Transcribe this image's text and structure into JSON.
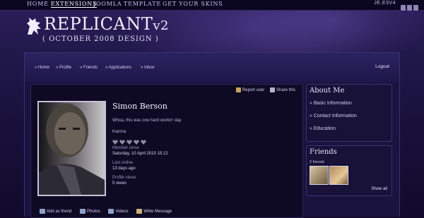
{
  "top_nav": {
    "items": [
      "HOME",
      "EXTENSIONS",
      "JOOMLA",
      "TEMPLATE",
      "GET YOUR SKINS"
    ],
    "right_text": "JE.E3V4"
  },
  "logo": {
    "title": "REPLICANT",
    "version": "v2",
    "subtitle": "( OCTOBER 2008 DESIGN )"
  },
  "sub_nav": {
    "items": [
      "» Home",
      "» Profile",
      "» Friends",
      "» Applications",
      "» Inbox"
    ],
    "logout": "Logout"
  },
  "profile": {
    "report_user": "Report user",
    "share_this": "Share this",
    "name": "Simon Berson",
    "status": "Whoa, this was one hard workin' day",
    "karma_label": "Karma",
    "karma_count": 5,
    "member_since_label": "Member since",
    "member_since": "Saturday, 10 April 2010 15:12",
    "last_online_label": "Last online",
    "last_online": "13 days ago",
    "profile_views_label": "Profile views",
    "profile_views": "5 views",
    "actions": [
      "Add as friend",
      "Photos",
      "Videos",
      "Write Message"
    ]
  },
  "about_me": {
    "title": "About Me",
    "items": [
      "» Basic Information",
      "» Contact Information",
      "» Education"
    ]
  },
  "friends": {
    "title": "Friends",
    "count_text": "2 friends",
    "show_all": "Show all"
  },
  "colors": {
    "background": "#120a2b",
    "panel": "#0f0a24",
    "accent": "#3d3474"
  }
}
